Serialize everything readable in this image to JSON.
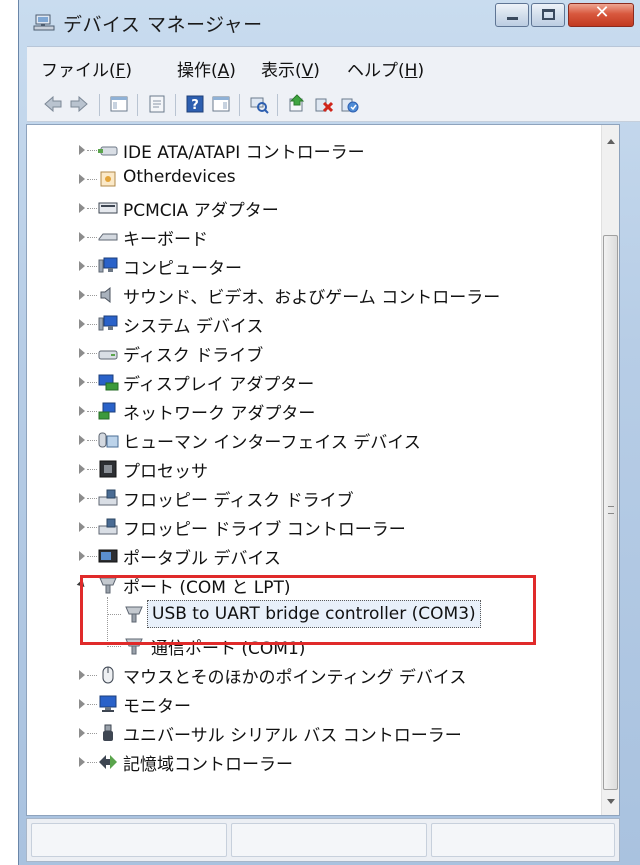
{
  "window": {
    "title": "デバイス マネージャー",
    "close_glyph": "✕"
  },
  "menu": [
    {
      "prefix": "ファイル(",
      "key": "F",
      "suffix": ")"
    },
    {
      "prefix": "操作(",
      "key": "A",
      "suffix": ")"
    },
    {
      "prefix": "表示(",
      "key": "V",
      "suffix": ")"
    },
    {
      "prefix": "ヘルプ(",
      "key": "H",
      "suffix": ")"
    }
  ],
  "toolbar": {
    "icons": [
      "back-arrow-icon",
      "forward-arrow-icon",
      "show-hide-console-tree-icon",
      "properties-icon",
      "help-icon",
      "show-hide-action-pane-icon",
      "scan-hardware-changes-icon",
      "update-driver-icon",
      "uninstall-icon",
      "enable-device-icon"
    ]
  },
  "tree": {
    "items": [
      {
        "label": "IDE ATA/ATAPI コントローラー",
        "icon": "ide-controller-icon"
      },
      {
        "label": "Otherdevices",
        "icon": "other-devices-icon"
      },
      {
        "label": "PCMCIA アダプター",
        "icon": "pcmcia-adapter-icon"
      },
      {
        "label": "キーボード",
        "icon": "keyboard-icon"
      },
      {
        "label": "コンピューター",
        "icon": "computer-icon"
      },
      {
        "label": "サウンド、ビデオ、およびゲーム コントローラー",
        "icon": "sound-icon"
      },
      {
        "label": "システム デバイス",
        "icon": "system-devices-icon"
      },
      {
        "label": "ディスク ドライブ",
        "icon": "disk-drive-icon"
      },
      {
        "label": "ディスプレイ アダプター",
        "icon": "display-adapter-icon"
      },
      {
        "label": "ネットワーク アダプター",
        "icon": "network-adapter-icon"
      },
      {
        "label": "ヒューマン インターフェイス デバイス",
        "icon": "hid-icon"
      },
      {
        "label": "プロセッサ",
        "icon": "processor-icon"
      },
      {
        "label": "フロッピー ディスク ドライブ",
        "icon": "floppy-drive-icon"
      },
      {
        "label": "フロッピー ドライブ コントローラー",
        "icon": "floppy-controller-icon"
      },
      {
        "label": "ポータブル デバイス",
        "icon": "portable-device-icon"
      },
      {
        "label": "ポート (COM と LPT)",
        "icon": "port-icon"
      },
      {
        "label": "USB to UART bridge controller (COM3)",
        "icon": "port-icon"
      },
      {
        "label": "通信ポート (COM1)",
        "icon": "port-icon"
      },
      {
        "label": "マウスとそのほかのポインティング デバイス",
        "icon": "mouse-icon"
      },
      {
        "label": "モニター",
        "icon": "monitor-icon"
      },
      {
        "label": "ユニバーサル シリアル バス コントローラー",
        "icon": "usb-icon"
      },
      {
        "label": "記憶域コントローラー",
        "icon": "storage-controller-icon"
      }
    ]
  },
  "colors": {
    "highlight_border": "#e02a2a",
    "window_frame": "#b7cde6"
  }
}
